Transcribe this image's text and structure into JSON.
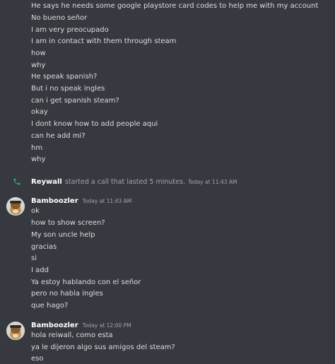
{
  "group1": {
    "lines": [
      "He says he needs some google playstore card codes to help me with my account",
      "No bueno señor",
      "I am very preocupado",
      "I am in contact with them through steam",
      "how",
      "why",
      "He speak spanish?",
      "But i no speak ingles",
      "can i get spanish steam?",
      "okay",
      "I dont know how to add people aqui",
      "can he add mi?",
      "hm",
      "why"
    ]
  },
  "call": {
    "icon": "phone-icon",
    "user": "Reywall",
    "text": "started a call that lasted 5 minutes.",
    "timestamp": "Today at 11:43 AM",
    "color": "#3ba55c"
  },
  "group2": {
    "author": "Bamboozler",
    "timestamp": "Today at 11:43 AM",
    "lines": [
      "ok",
      "how to show screen?",
      "My son uncle help",
      "gracias",
      "si",
      "I add",
      "Ya estoy hablando con el señor",
      "pero no habla ingles",
      "que hago?"
    ]
  },
  "group3": {
    "author": "Bamboozler",
    "timestamp": "Today at 12:00 PM",
    "lines": [
      "hola reiwall, como esta",
      "ya le dijeron algo sus amigos del steam?",
      "eso"
    ]
  }
}
